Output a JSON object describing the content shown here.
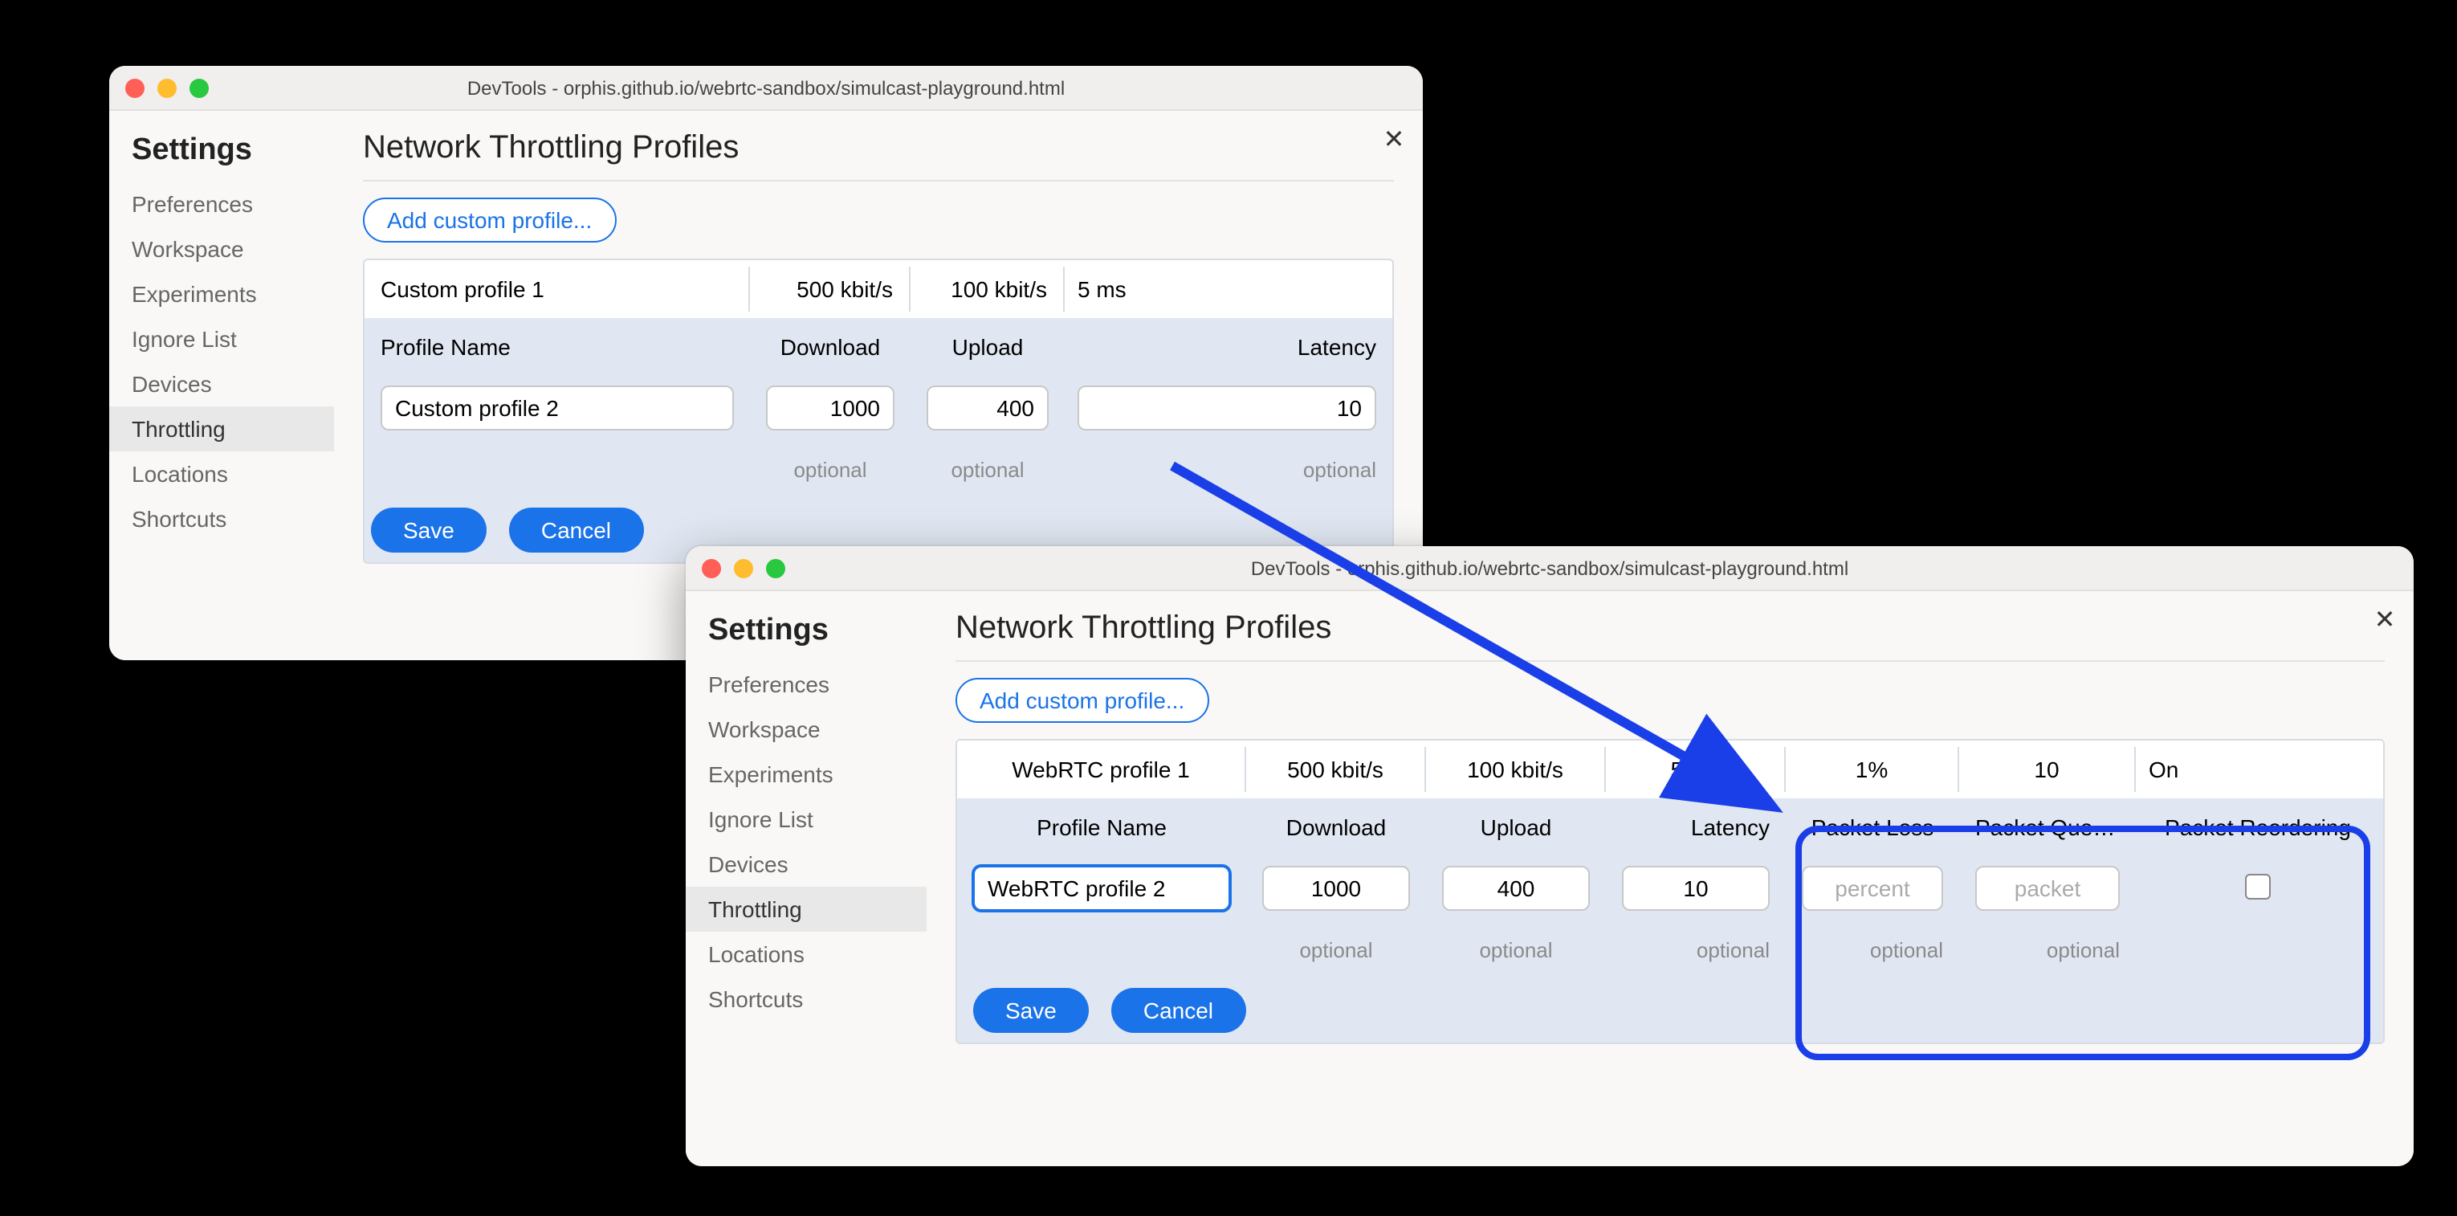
{
  "windowTitle": "DevTools - orphis.github.io/webrtc-sandbox/simulcast-playground.html",
  "settingsTitle": "Settings",
  "pageHeading": "Network Throttling Profiles",
  "addProfileLabel": "Add custom profile...",
  "sidebarItems": [
    "Preferences",
    "Workspace",
    "Experiments",
    "Ignore List",
    "Devices",
    "Throttling",
    "Locations",
    "Shortcuts"
  ],
  "sidebarSelected": "Throttling",
  "buttons": {
    "save": "Save",
    "cancel": "Cancel"
  },
  "optionalLabel": "optional",
  "narrow": {
    "headers": [
      "Profile Name",
      "Download",
      "Upload",
      "Latency"
    ],
    "existingRow": {
      "name": "Custom profile 1",
      "download": "500 kbit/s",
      "upload": "100 kbit/s",
      "latency": "5 ms"
    },
    "editRow": {
      "name": "Custom profile 2",
      "download": "1000",
      "upload": "400",
      "latency": "10"
    }
  },
  "wide": {
    "headers": [
      "Profile Name",
      "Download",
      "Upload",
      "Latency",
      "Packet Loss",
      "Packet Queue Length",
      "Packet Reordering"
    ],
    "existingRow": {
      "name": "WebRTC profile 1",
      "download": "500 kbit/s",
      "upload": "100 kbit/s",
      "latency": "5 ms",
      "loss": "1%",
      "queue": "10",
      "reorder": "On"
    },
    "editRow": {
      "name": "WebRTC profile 2",
      "download": "1000",
      "upload": "400",
      "latency": "10",
      "lossPH": "percent",
      "queuePH": "packet"
    }
  }
}
